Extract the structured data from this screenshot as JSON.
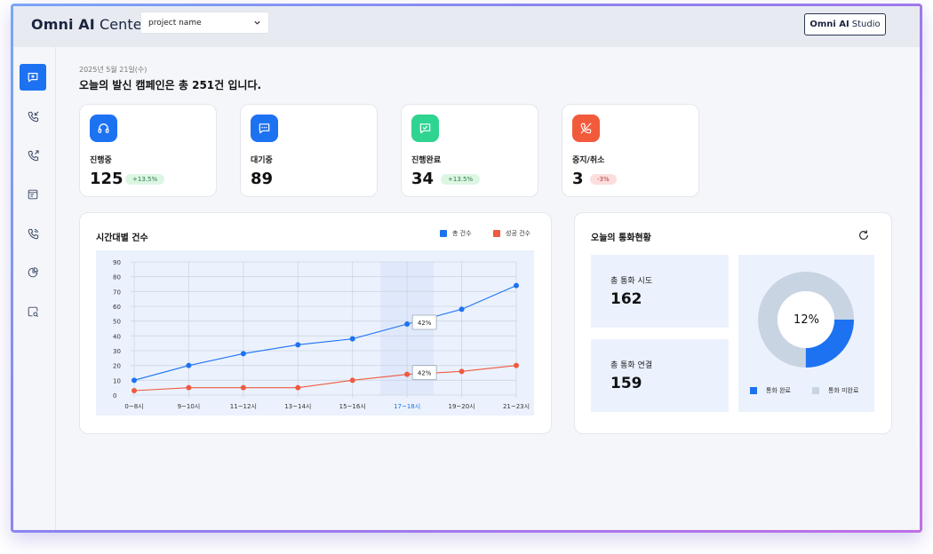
{
  "header": {
    "brand_bold": "Omni AI",
    "brand_rest": "Center",
    "project_select": "project name",
    "studio_bold": "Omni AI",
    "studio_rest": "Studio"
  },
  "sidebar": {
    "items": [
      {
        "icon": "chat-plus-icon",
        "active": true
      },
      {
        "icon": "incoming-call-icon",
        "active": false
      },
      {
        "icon": "outgoing-call-icon",
        "active": false
      },
      {
        "icon": "document-list-icon",
        "active": false
      },
      {
        "icon": "phone-ringing-icon",
        "active": false
      },
      {
        "icon": "pie-chart-icon",
        "active": false
      },
      {
        "icon": "search-settings-icon",
        "active": false
      }
    ]
  },
  "summary": {
    "date": "2025년 5월 21일(수)",
    "headline": "오늘의 발신 캠페인은 총 251건 입니다."
  },
  "stats": [
    {
      "label": "진행중",
      "value": "125",
      "badge": "+13.5%",
      "badge_type": "green",
      "icon": "headset-icon",
      "color": "#1d72f2"
    },
    {
      "label": "대기중",
      "value": "89",
      "badge": "",
      "badge_type": "",
      "icon": "chat-bubble-icon",
      "color": "#1d72f2"
    },
    {
      "label": "진행완료",
      "value": "34",
      "badge": "+13.5%",
      "badge_type": "green",
      "icon": "chat-check-icon",
      "color": "#2fd490"
    },
    {
      "label": "중지/취소",
      "value": "3",
      "badge": "-3%",
      "badge_type": "red",
      "icon": "phone-cancel-icon",
      "color": "#f25a3c"
    }
  ],
  "hourly": {
    "title": "시간대별 건수",
    "legend_total": "총 건수",
    "legend_success": "성공 건수",
    "total_color": "#1d72f2",
    "success_color": "#ef5a40",
    "tooltip_total": "42%",
    "tooltip_success": "42%"
  },
  "chart_data": {
    "type": "line",
    "categories": [
      "0~8시",
      "9~10시",
      "11~12시",
      "13~14시",
      "15~16시",
      "17~18시",
      "19~20시",
      "21~23시"
    ],
    "highlight_category": "17~18시",
    "series": [
      {
        "name": "총 건수",
        "values": [
          10,
          20,
          28,
          34,
          38,
          48,
          58,
          74
        ]
      },
      {
        "name": "성공 건수",
        "values": [
          3,
          5,
          5,
          5,
          10,
          14,
          16,
          20
        ]
      }
    ],
    "yticks": [
      0,
      10,
      20,
      30,
      40,
      50,
      60,
      70,
      80,
      90
    ],
    "ylim": [
      0,
      90
    ],
    "grid": true,
    "legend": "top-right"
  },
  "calls": {
    "title": "오늘의 통화현황",
    "attempt_label": "총 통화 시도",
    "attempt_value": "162",
    "connect_label": "총 통화 연결",
    "connect_value": "159",
    "donut_pct": "12%",
    "donut_fraction": 0.25,
    "legend_done": "통화 완료",
    "legend_pending": "통화 미완료",
    "done_color": "#1d72f2",
    "pending_color": "#c9d4e3"
  }
}
